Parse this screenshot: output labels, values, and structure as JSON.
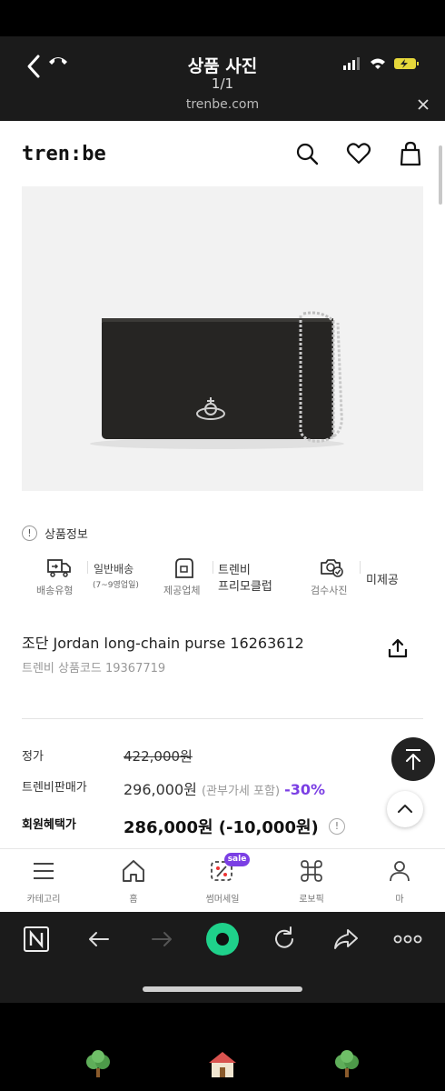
{
  "viewer": {
    "title": "상품 사진",
    "count": "1/1",
    "url": "trenbe.com"
  },
  "site": {
    "logo": "tren:be"
  },
  "product_info": {
    "label": "상품정보",
    "features": [
      {
        "icon": "delivery-truck-icon",
        "caption": "배송유형",
        "value1": "일반배송",
        "value2": "(7~9영업일)"
      },
      {
        "icon": "store-icon",
        "caption": "제공업체",
        "value1": "트렌비",
        "value2": "프리모클럽"
      },
      {
        "icon": "camera-check-icon",
        "caption": "검수사진",
        "value1": "미제공"
      }
    ]
  },
  "product": {
    "name": "조단 Jordan long-chain purse 16263612",
    "code": "트렌비 상품코드 19367719"
  },
  "prices": {
    "list_label": "정가",
    "list_price": "422,000원",
    "sale_label": "트렌비판매가",
    "sale_price": "296,000원",
    "vat_note": "(관부가세 포함)",
    "discount": "-30%",
    "member_label": "회원혜택가",
    "member_price": "286,000원 (-10,000원)"
  },
  "nav": {
    "items": [
      {
        "label": "카테고리",
        "icon": "menu-icon"
      },
      {
        "label": "홈",
        "icon": "home-icon"
      },
      {
        "label": "썸머세일",
        "icon": "percent-icon",
        "badge": "sale"
      },
      {
        "label": "로보픽",
        "icon": "command-icon"
      },
      {
        "label": "마",
        "icon": "user-icon"
      }
    ]
  },
  "colors": {
    "accent": "#7b3fe4",
    "browser_green": "#1fd18b"
  }
}
